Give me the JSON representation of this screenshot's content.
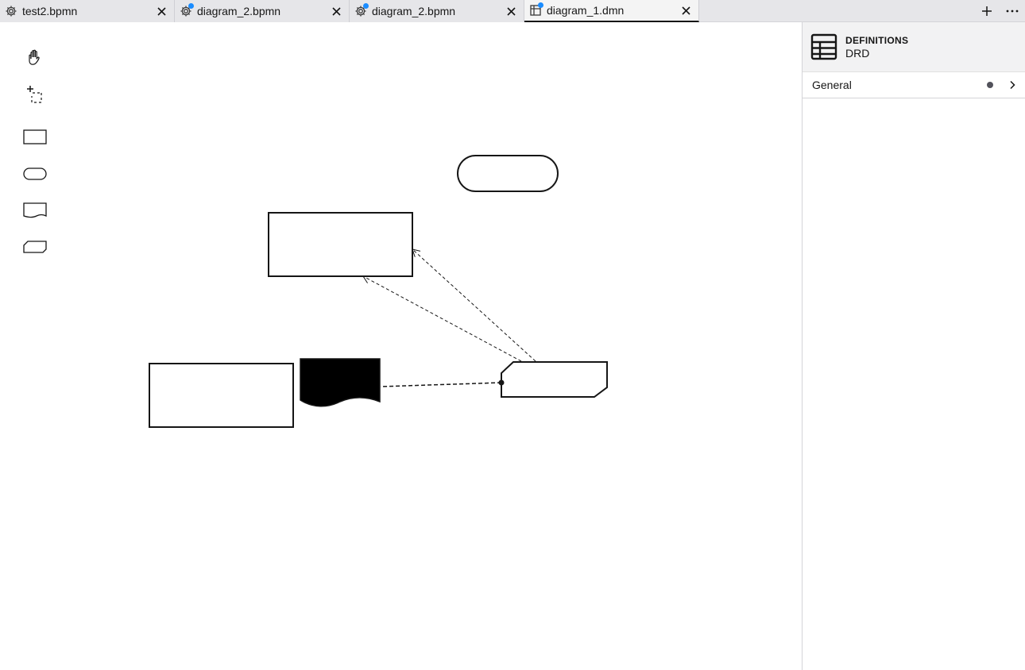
{
  "tabs": [
    {
      "label": "test2.bpmn",
      "icon": "gear-icon",
      "unsaved": false,
      "active": false
    },
    {
      "label": "diagram_2.bpmn",
      "icon": "gear-icon",
      "unsaved": true,
      "active": false
    },
    {
      "label": "diagram_2.bpmn",
      "icon": "gear-icon",
      "unsaved": true,
      "active": false
    },
    {
      "label": "diagram_1.dmn",
      "icon": "dmn-icon",
      "unsaved": true,
      "active": true
    }
  ],
  "tab_actions": {
    "add": "+",
    "more": "⋯"
  },
  "palette": [
    {
      "name": "hand-tool",
      "icon": "hand-icon"
    },
    {
      "name": "lasso-tool",
      "icon": "lasso-icon"
    },
    {
      "name": "create-decision",
      "icon": "rectangle-icon"
    },
    {
      "name": "create-input-data",
      "icon": "rounded-rectangle-icon"
    },
    {
      "name": "create-knowledge-source",
      "icon": "wavy-rectangle-icon"
    },
    {
      "name": "create-business-knowledge-model",
      "icon": "clipped-rectangle-icon"
    }
  ],
  "properties": {
    "type": "DEFINITIONS",
    "name": "DRD",
    "groups": [
      {
        "label": "General",
        "has_data": true
      }
    ]
  },
  "colors": {
    "accent": "#1a8cff",
    "tabbar": "#e6e6e9",
    "panel_header": "#f2f2f3"
  }
}
